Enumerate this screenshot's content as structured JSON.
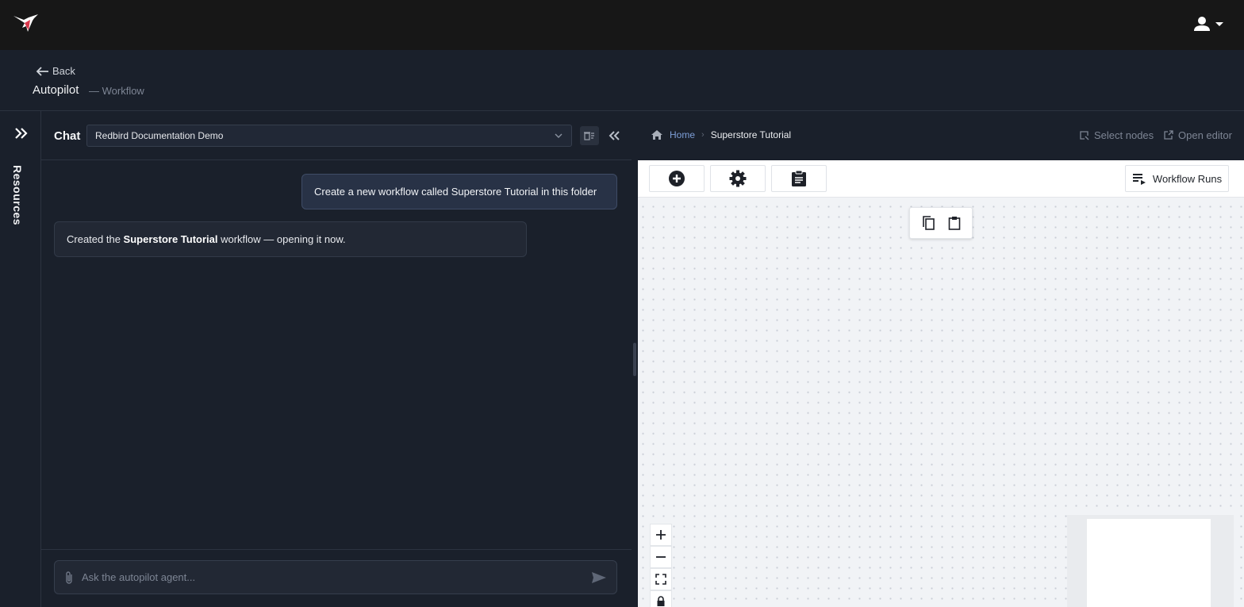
{
  "topbar": {
    "logo_icon": "hummingbird-logo-icon",
    "user_icon": "person-icon"
  },
  "header": {
    "back_label": "Back",
    "title": "Autopilot",
    "subtitle": "— Workflow"
  },
  "resources": {
    "label": "Resources"
  },
  "chat": {
    "title": "Chat",
    "project": "Redbird Documentation Demo",
    "messages": {
      "user_1": "Create a new workflow called Superstore Tutorial in this folder",
      "agent_1_prefix": "Created the ",
      "agent_1_bold": "Superstore Tutorial",
      "agent_1_suffix": " workflow — opening it now."
    },
    "input_placeholder": "Ask the autopilot agent..."
  },
  "workflow": {
    "breadcrumb": {
      "home": "Home",
      "current": "Superstore Tutorial"
    },
    "select_nodes_label": "Select nodes",
    "open_editor_label": "Open editor",
    "runs_label": "Workflow Runs"
  },
  "colors": {
    "accent_red": "#d8364a",
    "link_blue": "#7e9fd8",
    "canvas_bg": "#f1f3f6"
  }
}
